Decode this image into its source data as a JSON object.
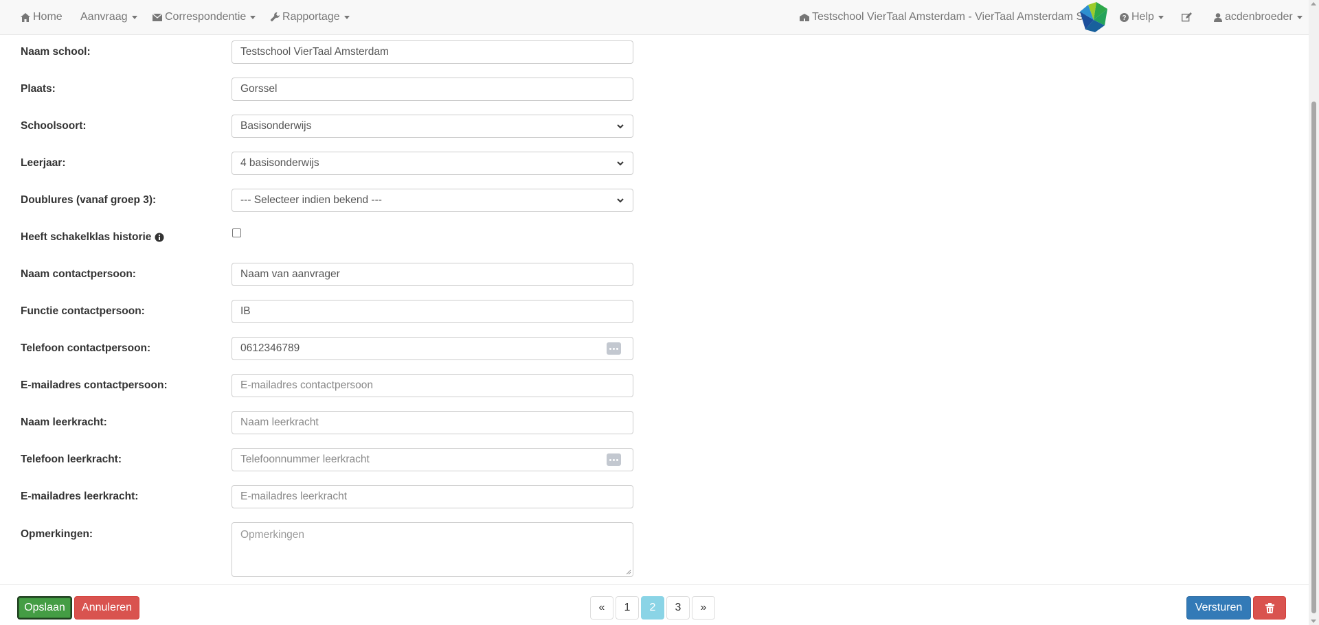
{
  "navbar": {
    "home": "Home",
    "aanvraag": "Aanvraag",
    "correspondentie": "Correspondentie",
    "rapportage": "Rapportage",
    "school": "Testschool VierTaal Amsterdam - VierTaal Amsterdam SO",
    "help": "Help",
    "user": "acdenbroeder"
  },
  "form": {
    "naam_school": {
      "label": "Naam school:",
      "value": "Testschool VierTaal Amsterdam"
    },
    "plaats": {
      "label": "Plaats:",
      "value": "Gorssel"
    },
    "schoolsoort": {
      "label": "Schoolsoort:",
      "value": "Basisonderwijs"
    },
    "leerjaar": {
      "label": "Leerjaar:",
      "value": "4 basisonderwijs"
    },
    "doublures": {
      "label": "Doublures (vanaf groep 3):",
      "value": "--- Selecteer indien bekend ---"
    },
    "schakelklas": {
      "label": "Heeft schakelklas historie",
      "checked": false
    },
    "naam_contactpersoon": {
      "label": "Naam contactpersoon:",
      "value": "Naam van aanvrager"
    },
    "functie_contactpersoon": {
      "label": "Functie contactpersoon:",
      "value": "IB"
    },
    "telefoon_contactpersoon": {
      "label": "Telefoon contactpersoon:",
      "value": "0612346789"
    },
    "email_contactpersoon": {
      "label": "E-mailadres contactpersoon:",
      "placeholder": "E-mailadres  contactpersoon"
    },
    "naam_leerkracht": {
      "label": "Naam leerkracht:",
      "placeholder": "Naam leerkracht"
    },
    "telefoon_leerkracht": {
      "label": "Telefoon leerkracht:",
      "placeholder": "Telefoonnummer leerkracht"
    },
    "email_leerkracht": {
      "label": "E-mailadres leerkracht:",
      "placeholder": "E-mailadres leerkracht"
    },
    "opmerkingen": {
      "label": "Opmerkingen:",
      "placeholder": "Opmerkingen"
    }
  },
  "footer": {
    "save": "Opslaan",
    "cancel": "Annuleren",
    "send": "Versturen",
    "pager": {
      "prev": "«",
      "p1": "1",
      "p2": "2",
      "p3": "3",
      "next": "»"
    }
  },
  "colors": {
    "save_button": "#449d44",
    "cancel_button": "#d9534f",
    "send_button": "#337ab7",
    "pager_active": "#8ad4e6"
  }
}
